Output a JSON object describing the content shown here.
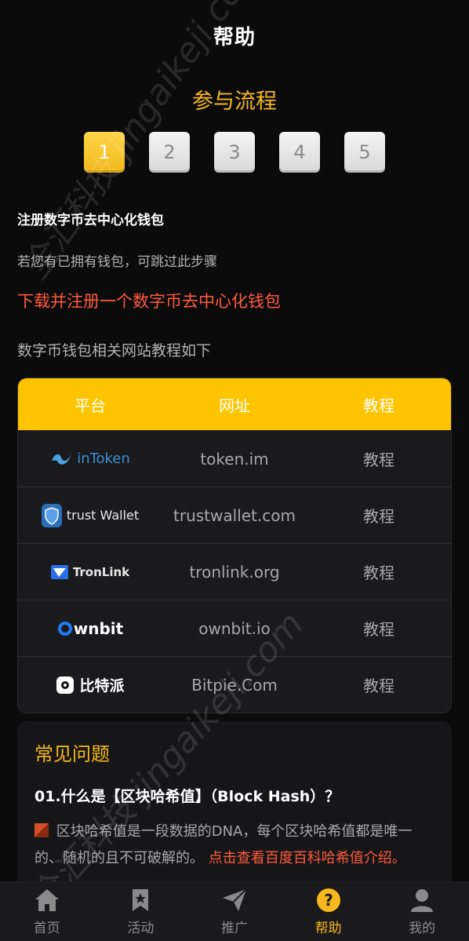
{
  "header": {
    "title": "帮助"
  },
  "flow": {
    "title": "参与流程",
    "steps": [
      "1",
      "2",
      "3",
      "4",
      "5"
    ],
    "active_step": 1
  },
  "step_content": {
    "heading": "注册数字币去中心化钱包",
    "note": "若您有已拥有钱包，可跳过此步骤",
    "link": "下载并注册一个数字币去中心化钱包",
    "desc": "数字币钱包相关网站教程如下"
  },
  "wallet_table": {
    "headers": [
      "平台",
      "网址",
      "教程"
    ],
    "rows": [
      {
        "platform": "inToken",
        "url": "token.im",
        "tutorial": "教程",
        "icon": "intoken-logo-icon"
      },
      {
        "platform": "trust Wallet",
        "url": "trustwallet.com",
        "tutorial": "教程",
        "icon": "trust-wallet-shield-icon"
      },
      {
        "platform": "TronLink",
        "url": "tronlink.org",
        "tutorial": "教程",
        "icon": "tronlink-logo-icon"
      },
      {
        "platform": "wnbit",
        "url": "ownbit.io",
        "tutorial": "教程",
        "icon": "ownbit-logo-icon"
      },
      {
        "platform": "比特派",
        "url": "Bitpie.Com",
        "tutorial": "教程",
        "icon": "bitpie-logo-icon"
      }
    ]
  },
  "faq": {
    "title": "常见问题",
    "question": "01.什么是【区块哈希值】（Block Hash）？",
    "answer": "区块哈希值是一段数据的DNA，每个区块哈希值都是唯一的、随机的且不可破解的。",
    "answer_link": "点击查看百度百科哈希值介绍。"
  },
  "watermark": "jingaikeji.com",
  "tabbar": {
    "items": [
      {
        "label": "首页",
        "icon": "home-icon"
      },
      {
        "label": "活动",
        "icon": "bookmark-star-icon"
      },
      {
        "label": "推广",
        "icon": "paper-plane-icon"
      },
      {
        "label": "帮助",
        "icon": "question-icon"
      },
      {
        "label": "我的",
        "icon": "user-icon"
      }
    ],
    "active_index": 3
  },
  "colors": {
    "accent": "#f6b81c",
    "link": "#ff5a3c",
    "table_header": "#ffc400",
    "background": "#0b0b0c"
  }
}
